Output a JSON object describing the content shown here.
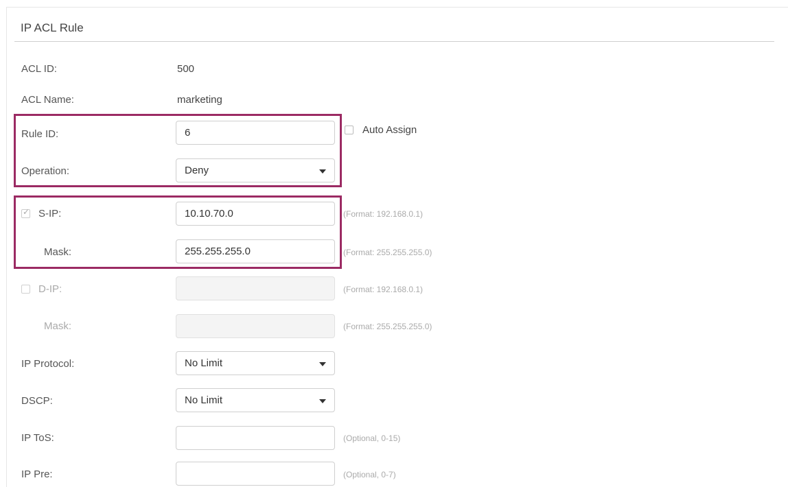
{
  "section": {
    "title": "IP ACL Rule"
  },
  "acl_id": {
    "label": "ACL ID:",
    "value": "500"
  },
  "acl_name": {
    "label": "ACL Name:",
    "value": "marketing"
  },
  "rule_id": {
    "label": "Rule ID:",
    "value": "6",
    "auto_assign_label": "Auto Assign",
    "auto_assign_checked": false
  },
  "operation": {
    "label": "Operation:",
    "value": "Deny"
  },
  "s_ip": {
    "label": "S-IP:",
    "checked": true,
    "value": "10.10.70.0",
    "format": "(Format: 192.168.0.1)"
  },
  "s_mask": {
    "label": "Mask:",
    "value": "255.255.255.0",
    "format": "(Format: 255.255.255.0)"
  },
  "d_ip": {
    "label": "D-IP:",
    "checked": false,
    "value": "",
    "format": "(Format: 192.168.0.1)"
  },
  "d_mask": {
    "label": "Mask:",
    "value": "",
    "format": "(Format: 255.255.255.0)"
  },
  "ip_protocol": {
    "label": "IP Protocol:",
    "value": "No Limit"
  },
  "dscp": {
    "label": "DSCP:",
    "value": "No Limit"
  },
  "ip_tos": {
    "label": "IP ToS:",
    "value": "",
    "hint": "(Optional, 0-15)"
  },
  "ip_pre": {
    "label": "IP Pre:",
    "value": "",
    "hint": "(Optional, 0-7)"
  },
  "colors": {
    "highlight": "#9b2a63",
    "rule": "#cfcfcf",
    "input_border": "#cfcfcf",
    "disabled_bg": "#f4f4f4"
  },
  "icons": {
    "dropdown": "caret-down-icon",
    "check": "checkmark-icon"
  }
}
